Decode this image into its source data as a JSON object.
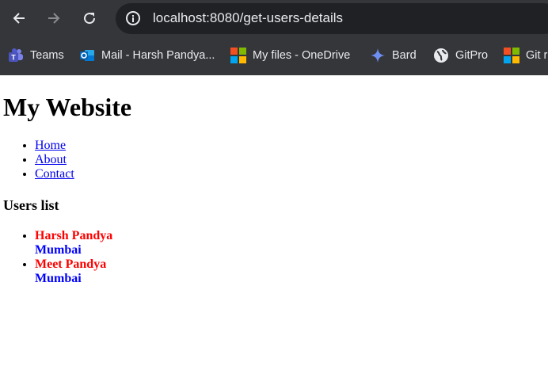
{
  "browser": {
    "url": "localhost:8080/get-users-details",
    "bookmarks": [
      {
        "label": "Teams",
        "icon": "teams-icon"
      },
      {
        "label": "Mail - Harsh Pandya...",
        "icon": "outlook-icon"
      },
      {
        "label": "My files - OneDrive",
        "icon": "microsoft-icon"
      },
      {
        "label": "Bard",
        "icon": "bard-icon"
      },
      {
        "label": "GitPro",
        "icon": "globe-icon"
      },
      {
        "label": "Git r",
        "icon": "microsoft-icon"
      }
    ]
  },
  "page": {
    "title": "My Website",
    "nav": [
      {
        "label": "Home"
      },
      {
        "label": "About"
      },
      {
        "label": "Contact"
      }
    ],
    "users_heading": "Users list",
    "users": [
      {
        "name": "Harsh Pandya",
        "city": "Mumbai"
      },
      {
        "name": "Meet Pandya",
        "city": "Mumbai"
      }
    ]
  },
  "colors": {
    "chrome_bg": "#35363a",
    "omnibox_bg": "#202124",
    "link": "#0000ee",
    "user_name": "#ff0000",
    "user_city": "#0000ff"
  }
}
